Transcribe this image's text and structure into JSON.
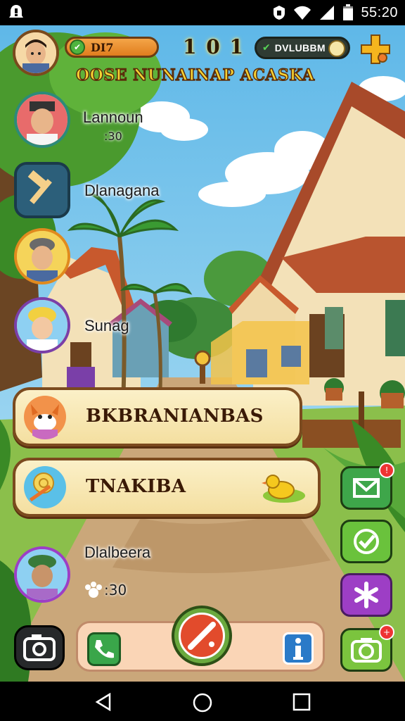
{
  "status_bar": {
    "clock": "55:20",
    "left_icon": "notification-icon",
    "icons": [
      "vpn-key-icon",
      "wifi-icon",
      "signal-icon",
      "battery-icon"
    ]
  },
  "hud": {
    "coin_pill_text": "DI7",
    "level": "1 0 1",
    "dark_pill_text": "DVLUBBM",
    "village_title": "OOSE NUNAINAP ACASKA"
  },
  "friends": [
    {
      "name": "Lannoun",
      "sub": ":30"
    },
    {
      "name": "Dlanagana",
      "sub": ""
    },
    {
      "name": "",
      "sub": ""
    },
    {
      "name": "Sunag",
      "sub": ""
    },
    {
      "name": "Dlalbeera",
      "sub": ":30"
    }
  ],
  "banners": [
    {
      "label": "BKBRANIANBAS",
      "icon": "fox-icon"
    },
    {
      "label": "TNAKIBA",
      "icon": "lollipop-icon"
    }
  ],
  "right_buttons": [
    {
      "name": "mail-button",
      "icon": "envelope-icon",
      "color": "#3ea64a"
    },
    {
      "name": "check-button",
      "icon": "check-icon",
      "color": "#6ac23c"
    },
    {
      "name": "asterisk-button",
      "icon": "asterisk-icon",
      "color": "#9d3ec5"
    },
    {
      "name": "camera-button",
      "icon": "camera-icon",
      "color": "#7bc43e"
    }
  ],
  "colors": {
    "sky": "#7cc8ec",
    "panel": "#f4dfa0",
    "panel_border": "#7b4a1e",
    "title_gold": "#f6d233"
  }
}
